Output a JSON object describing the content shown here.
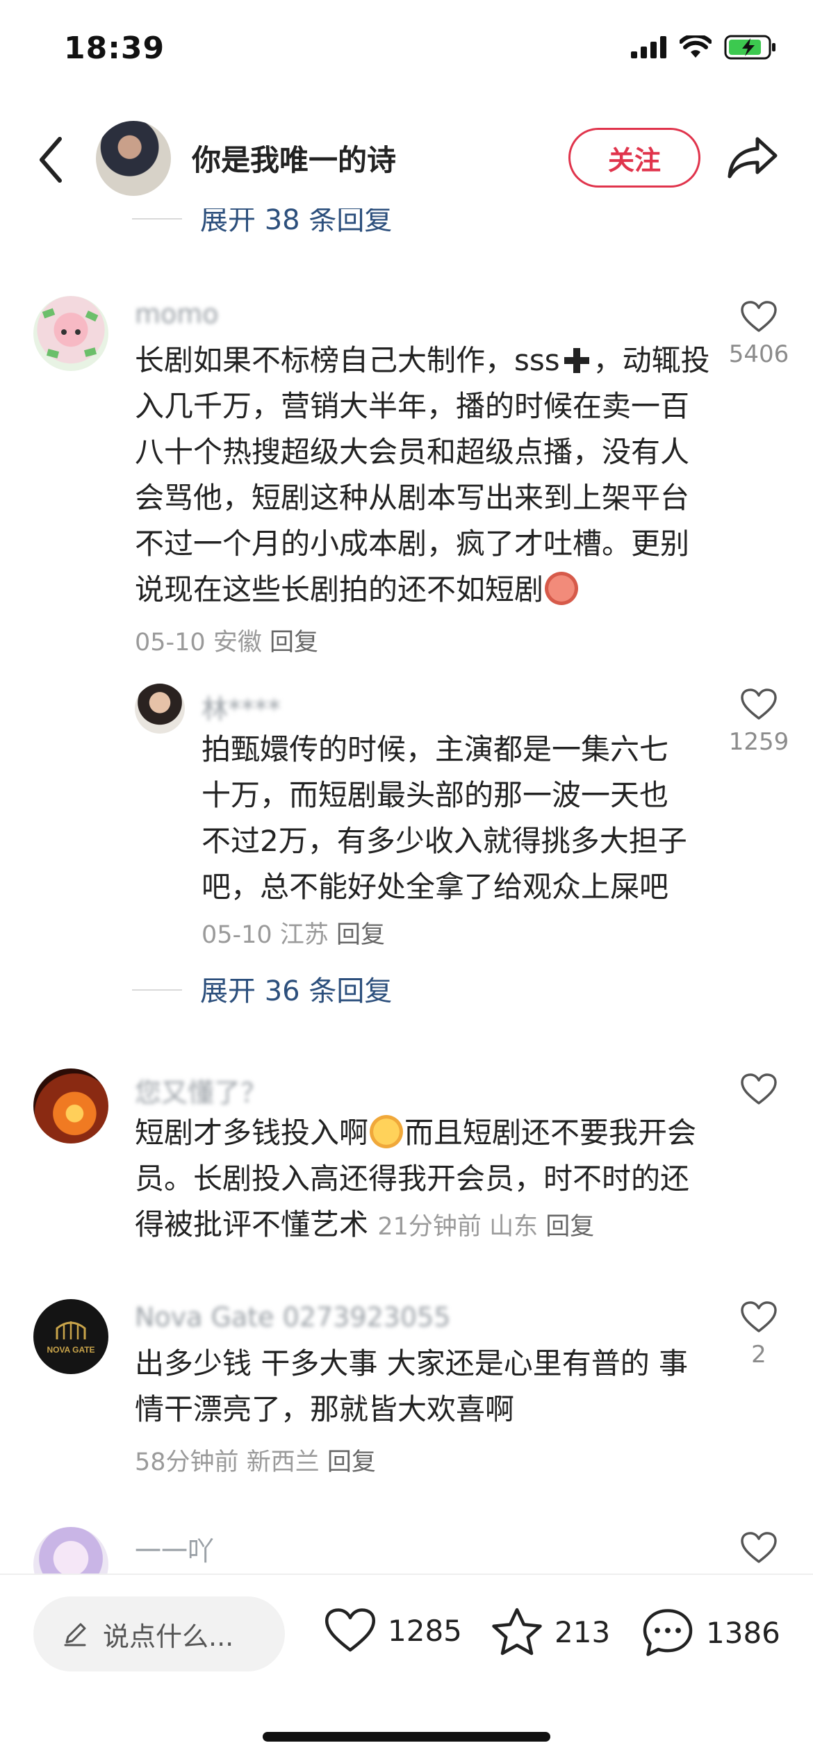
{
  "status_bar": {
    "time": "18:39"
  },
  "header": {
    "title": "你是我唯一的诗",
    "follow_label": "关注"
  },
  "comments": {
    "top_expand": "展开 38 条回复",
    "c1": {
      "user": "momo",
      "text_before": "长剧如果不标榜自己大制作，sss",
      "text_after": "，动辄投入几千万，营销大半年，播的时候在卖一百八十个热搜超级大会员和超级点播，没有人会骂他，短剧这种从剧本写出来到上架平台不过一个月的小成本剧，疯了才吐槽。更别说现在这些长剧拍的还不如短剧",
      "date": "05-10",
      "location": "安徽",
      "reply": "回复",
      "likes": "5406"
    },
    "r1": {
      "user": "林****",
      "text": "拍甄嬛传的时候，主演都是一集六七十万，而短剧最头部的那一波一天也不过2万，有多少收入就得挑多大担子吧，总不能好处全拿了给观众上屎吧",
      "date": "05-10",
      "location": "江苏",
      "reply": "回复",
      "likes": "1259",
      "expand": "展开 36 条回复"
    },
    "c2": {
      "user": "您又懂了？",
      "text_before": "短剧才多钱投入啊",
      "text_after": "而且短剧还不要我开会员。长剧投入高还得我开会员，时不时的还得被批评不懂艺术",
      "time": "21分钟前",
      "location": "山东",
      "reply": "回复"
    },
    "c3": {
      "user": "Nova Gate 0273923055",
      "avatar_text": "NOVA GATE",
      "text": "出多少钱 干多大事 大家还是心里有普的 事情干漂亮了，那就皆大欢喜啊",
      "time": "58分钟前",
      "location": "新西兰",
      "reply": "回复",
      "likes": "2"
    },
    "c4": {
      "user": "一一吖"
    }
  },
  "bottom_bar": {
    "input_placeholder": "说点什么...",
    "likes": "1285",
    "favorites": "213",
    "comments": "1386"
  },
  "colors": {
    "accent": "#e0344c",
    "link": "#2c4f7c",
    "meta": "#9a9a9a"
  }
}
